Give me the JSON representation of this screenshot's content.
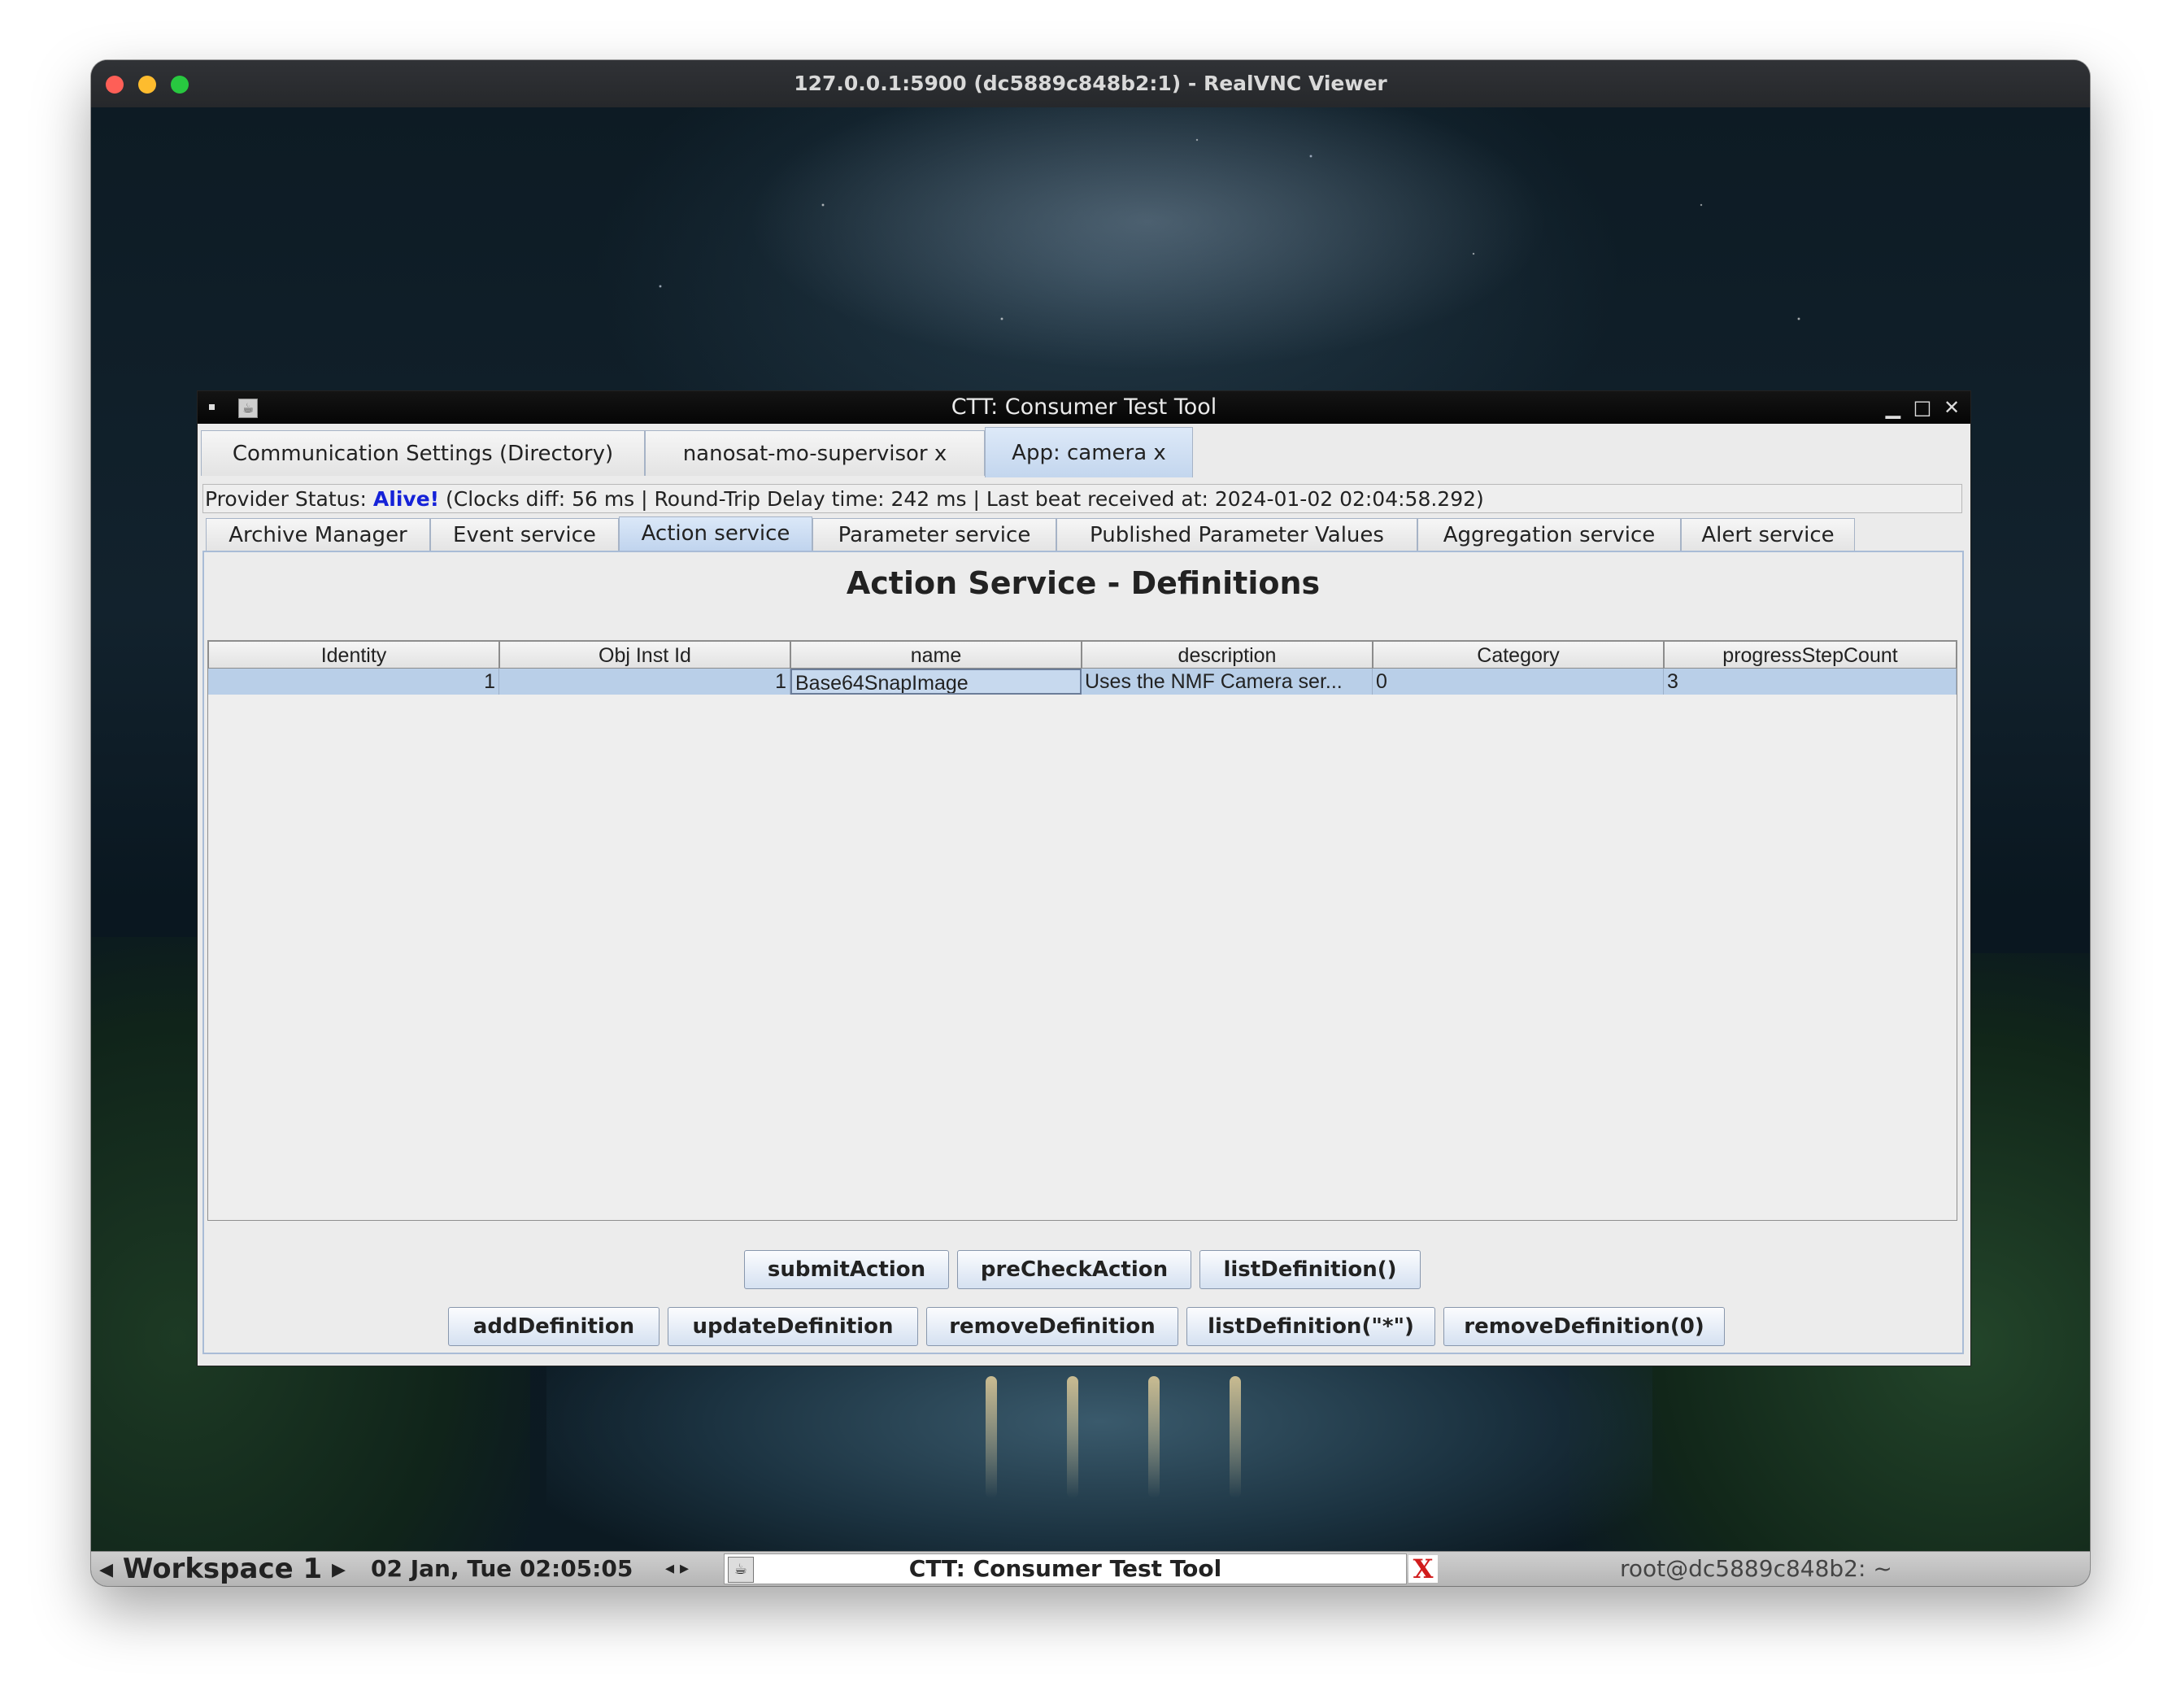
{
  "mac_window": {
    "title": "127.0.0.1:5900 (dc5889c848b2:1) - RealVNC Viewer"
  },
  "ctt_window": {
    "title": "CTT: Consumer Test Tool",
    "main_tabs": [
      {
        "label": "Communication Settings (Directory)"
      },
      {
        "label": "nanosat-mo-supervisor x"
      },
      {
        "label": "App: camera x",
        "active": true
      }
    ],
    "status": {
      "prefix": "Provider Status:",
      "state": "Alive!",
      "details": "(Clocks diff: 56 ms | Round-Trip Delay time: 242 ms | Last beat received at: 2024-01-02 02:04:58.292)"
    },
    "service_tabs": [
      {
        "label": "Archive Manager"
      },
      {
        "label": "Event service"
      },
      {
        "label": "Action service",
        "active": true
      },
      {
        "label": "Parameter service"
      },
      {
        "label": "Published Parameter Values"
      },
      {
        "label": "Aggregation service"
      },
      {
        "label": "Alert service"
      }
    ],
    "panel_title": "Action Service - Definitions",
    "table": {
      "columns": [
        "Identity",
        "Obj Inst Id",
        "name",
        "description",
        "Category",
        "progressStepCount"
      ],
      "rows": [
        [
          "1",
          "1",
          "Base64SnapImage",
          "Uses the NMF Camera ser...",
          "0",
          "3"
        ]
      ]
    },
    "buttons_row1": [
      "submitAction",
      "preCheckAction",
      "listDefinition()"
    ],
    "buttons_row2": [
      "addDefinition",
      "updateDefinition",
      "removeDefinition",
      "listDefinition(\"*\")",
      "removeDefinition(0)"
    ]
  },
  "taskbar": {
    "workspace": "Workspace 1",
    "clock": "02 Jan, Tue 02:05:05",
    "task_label": "CTT: Consumer Test Tool",
    "terminal": "root@dc5889c848b2: ~"
  },
  "colors": {
    "alive": "#1522d8",
    "selected_row": "#b9cfe8",
    "active_tab": "#c3d6ee"
  }
}
